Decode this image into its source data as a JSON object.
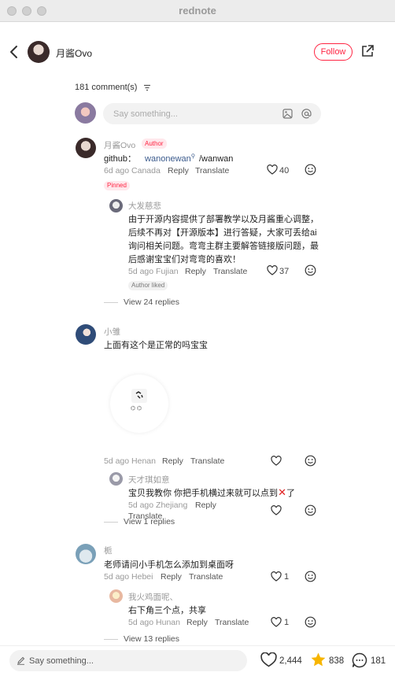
{
  "window": {
    "title": "rednote"
  },
  "header": {
    "author_name": "月酱Ovo",
    "follow_label": "Follow"
  },
  "comments_header": {
    "count_label": "181 comment(s)"
  },
  "composer": {
    "placeholder": "Say something..."
  },
  "comments": [
    {
      "name": "月酱Ovo",
      "badge": "Author",
      "body_prefix": "github：",
      "link": "wanonewan",
      "body_suffix": "/wanwan",
      "meta": "6d ago Canada",
      "reply": "Reply",
      "translate": "Translate",
      "likes": "40",
      "pinned": "Pinned",
      "sub": {
        "name": "大发慈悲",
        "lines": [
          "由于开源内容提供了部署教学以及月酱重心调整，",
          "后续不再对【开源版本】进行答疑，大家可丢给ai",
          "询问相关问题。弯弯主群主要解答链接版问题，最",
          "后感谢宝宝们对弯弯的喜欢！"
        ],
        "meta": "5d ago Fujian",
        "reply": "Reply",
        "translate": "Translate",
        "likes": "37",
        "liked": "Author liked"
      },
      "view_replies": "View 24 replies"
    },
    {
      "name": "小雏",
      "body": "上面有这个是正常的吗宝宝",
      "meta": "5d ago Henan",
      "reply": "Reply",
      "translate": "Translate",
      "sub": {
        "name": "天才琪如意",
        "body": "宝贝我教你 你把手机横过来就可以点到",
        "body_tail": "了",
        "meta": "5d ago Zhejiang",
        "reply": "Reply",
        "translate": "Translate"
      },
      "view_replies": "View 1 replies"
    },
    {
      "name": "栀",
      "body": "老师请问小手机怎么添加到桌面呀",
      "meta": "5d ago Hebei",
      "reply": "Reply",
      "translate": "Translate",
      "likes": "1",
      "sub": {
        "name": "我火鸡面呢、",
        "body": "右下角三个点，共享",
        "meta": "5d ago Hunan",
        "reply": "Reply",
        "translate": "Translate",
        "likes": "1"
      },
      "view_replies": "View 13 replies"
    }
  ],
  "footer": {
    "placeholder": "Say something...",
    "likes": "2,444",
    "stars": "838",
    "comments": "181"
  },
  "colors": {
    "accent": "#ff2442",
    "star": "#f7b500"
  }
}
